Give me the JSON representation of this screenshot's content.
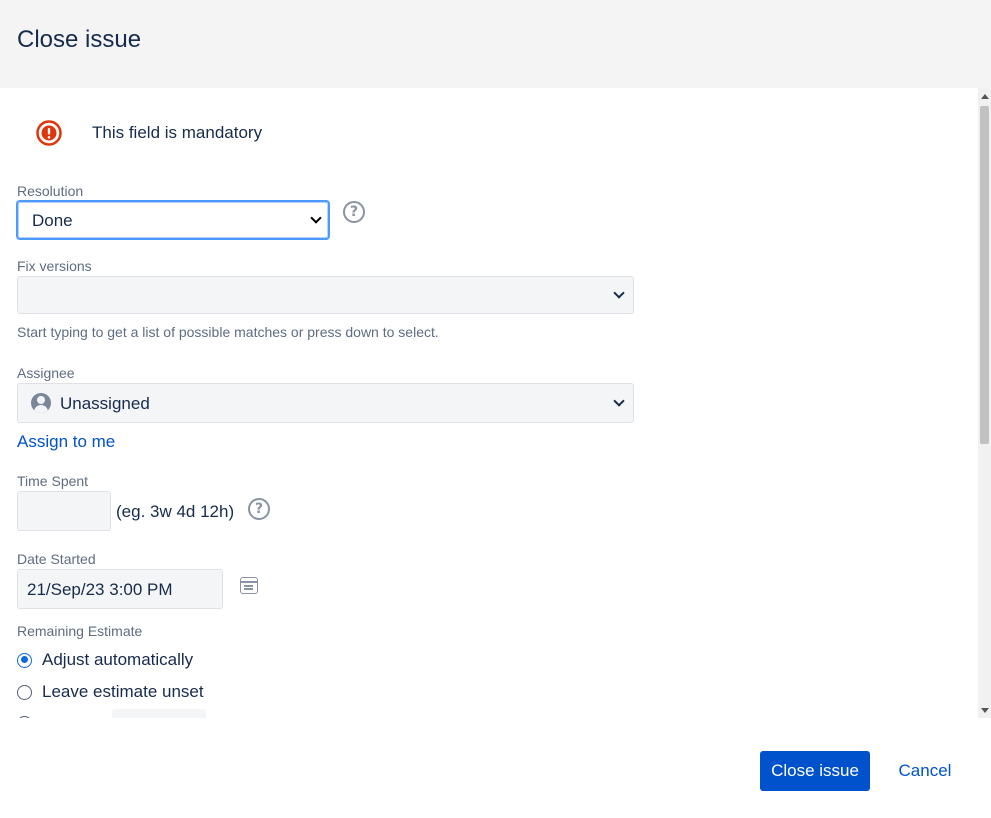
{
  "dialog": {
    "title": "Close issue"
  },
  "alert": {
    "icon": "error-icon",
    "message": "This field is mandatory",
    "color": "#de350b"
  },
  "fields": {
    "resolution": {
      "label": "Resolution",
      "value": "Done",
      "help_icon": "question-circle-icon"
    },
    "fix_versions": {
      "label": "Fix versions",
      "value": "",
      "hint": "Start typing to get a list of possible matches or press down to select."
    },
    "assignee": {
      "label": "Assignee",
      "value": "Unassigned",
      "avatar_icon": "user-avatar-icon",
      "assign_to_me_label": "Assign to me"
    },
    "time_spent": {
      "label": "Time Spent",
      "value": "",
      "example": "(eg. 3w 4d 12h)",
      "help_icon": "question-circle-icon"
    },
    "date_started": {
      "label": "Date Started",
      "value": "21/Sep/23 3:00 PM",
      "calendar_icon": "calendar-icon"
    },
    "remaining_estimate": {
      "label": "Remaining Estimate",
      "options": [
        {
          "label": "Adjust automatically",
          "checked": true
        },
        {
          "label": "Leave estimate unset",
          "checked": false
        }
      ]
    }
  },
  "footer": {
    "primary_label": "Close issue",
    "cancel_label": "Cancel"
  },
  "colors": {
    "accent": "#0052cc",
    "focus_ring": "#4c9aff",
    "header_bg": "#f4f4f4"
  }
}
